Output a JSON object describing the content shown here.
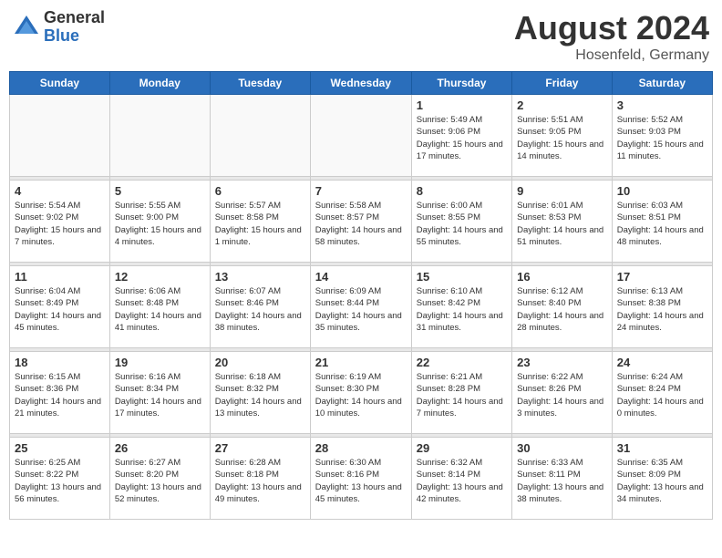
{
  "header": {
    "logo_general": "General",
    "logo_blue": "Blue",
    "title": "August 2024",
    "location": "Hosenfeld, Germany"
  },
  "days_of_week": [
    "Sunday",
    "Monday",
    "Tuesday",
    "Wednesday",
    "Thursday",
    "Friday",
    "Saturday"
  ],
  "weeks": [
    {
      "days": [
        {
          "num": "",
          "info": ""
        },
        {
          "num": "",
          "info": ""
        },
        {
          "num": "",
          "info": ""
        },
        {
          "num": "",
          "info": ""
        },
        {
          "num": "1",
          "info": "Sunrise: 5:49 AM\nSunset: 9:06 PM\nDaylight: 15 hours\nand 17 minutes."
        },
        {
          "num": "2",
          "info": "Sunrise: 5:51 AM\nSunset: 9:05 PM\nDaylight: 15 hours\nand 14 minutes."
        },
        {
          "num": "3",
          "info": "Sunrise: 5:52 AM\nSunset: 9:03 PM\nDaylight: 15 hours\nand 11 minutes."
        }
      ]
    },
    {
      "days": [
        {
          "num": "4",
          "info": "Sunrise: 5:54 AM\nSunset: 9:02 PM\nDaylight: 15 hours\nand 7 minutes."
        },
        {
          "num": "5",
          "info": "Sunrise: 5:55 AM\nSunset: 9:00 PM\nDaylight: 15 hours\nand 4 minutes."
        },
        {
          "num": "6",
          "info": "Sunrise: 5:57 AM\nSunset: 8:58 PM\nDaylight: 15 hours\nand 1 minute."
        },
        {
          "num": "7",
          "info": "Sunrise: 5:58 AM\nSunset: 8:57 PM\nDaylight: 14 hours\nand 58 minutes."
        },
        {
          "num": "8",
          "info": "Sunrise: 6:00 AM\nSunset: 8:55 PM\nDaylight: 14 hours\nand 55 minutes."
        },
        {
          "num": "9",
          "info": "Sunrise: 6:01 AM\nSunset: 8:53 PM\nDaylight: 14 hours\nand 51 minutes."
        },
        {
          "num": "10",
          "info": "Sunrise: 6:03 AM\nSunset: 8:51 PM\nDaylight: 14 hours\nand 48 minutes."
        }
      ]
    },
    {
      "days": [
        {
          "num": "11",
          "info": "Sunrise: 6:04 AM\nSunset: 8:49 PM\nDaylight: 14 hours\nand 45 minutes."
        },
        {
          "num": "12",
          "info": "Sunrise: 6:06 AM\nSunset: 8:48 PM\nDaylight: 14 hours\nand 41 minutes."
        },
        {
          "num": "13",
          "info": "Sunrise: 6:07 AM\nSunset: 8:46 PM\nDaylight: 14 hours\nand 38 minutes."
        },
        {
          "num": "14",
          "info": "Sunrise: 6:09 AM\nSunset: 8:44 PM\nDaylight: 14 hours\nand 35 minutes."
        },
        {
          "num": "15",
          "info": "Sunrise: 6:10 AM\nSunset: 8:42 PM\nDaylight: 14 hours\nand 31 minutes."
        },
        {
          "num": "16",
          "info": "Sunrise: 6:12 AM\nSunset: 8:40 PM\nDaylight: 14 hours\nand 28 minutes."
        },
        {
          "num": "17",
          "info": "Sunrise: 6:13 AM\nSunset: 8:38 PM\nDaylight: 14 hours\nand 24 minutes."
        }
      ]
    },
    {
      "days": [
        {
          "num": "18",
          "info": "Sunrise: 6:15 AM\nSunset: 8:36 PM\nDaylight: 14 hours\nand 21 minutes."
        },
        {
          "num": "19",
          "info": "Sunrise: 6:16 AM\nSunset: 8:34 PM\nDaylight: 14 hours\nand 17 minutes."
        },
        {
          "num": "20",
          "info": "Sunrise: 6:18 AM\nSunset: 8:32 PM\nDaylight: 14 hours\nand 13 minutes."
        },
        {
          "num": "21",
          "info": "Sunrise: 6:19 AM\nSunset: 8:30 PM\nDaylight: 14 hours\nand 10 minutes."
        },
        {
          "num": "22",
          "info": "Sunrise: 6:21 AM\nSunset: 8:28 PM\nDaylight: 14 hours\nand 7 minutes."
        },
        {
          "num": "23",
          "info": "Sunrise: 6:22 AM\nSunset: 8:26 PM\nDaylight: 14 hours\nand 3 minutes."
        },
        {
          "num": "24",
          "info": "Sunrise: 6:24 AM\nSunset: 8:24 PM\nDaylight: 14 hours\nand 0 minutes."
        }
      ]
    },
    {
      "days": [
        {
          "num": "25",
          "info": "Sunrise: 6:25 AM\nSunset: 8:22 PM\nDaylight: 13 hours\nand 56 minutes."
        },
        {
          "num": "26",
          "info": "Sunrise: 6:27 AM\nSunset: 8:20 PM\nDaylight: 13 hours\nand 52 minutes."
        },
        {
          "num": "27",
          "info": "Sunrise: 6:28 AM\nSunset: 8:18 PM\nDaylight: 13 hours\nand 49 minutes."
        },
        {
          "num": "28",
          "info": "Sunrise: 6:30 AM\nSunset: 8:16 PM\nDaylight: 13 hours\nand 45 minutes."
        },
        {
          "num": "29",
          "info": "Sunrise: 6:32 AM\nSunset: 8:14 PM\nDaylight: 13 hours\nand 42 minutes."
        },
        {
          "num": "30",
          "info": "Sunrise: 6:33 AM\nSunset: 8:11 PM\nDaylight: 13 hours\nand 38 minutes."
        },
        {
          "num": "31",
          "info": "Sunrise: 6:35 AM\nSunset: 8:09 PM\nDaylight: 13 hours\nand 34 minutes."
        }
      ]
    }
  ]
}
